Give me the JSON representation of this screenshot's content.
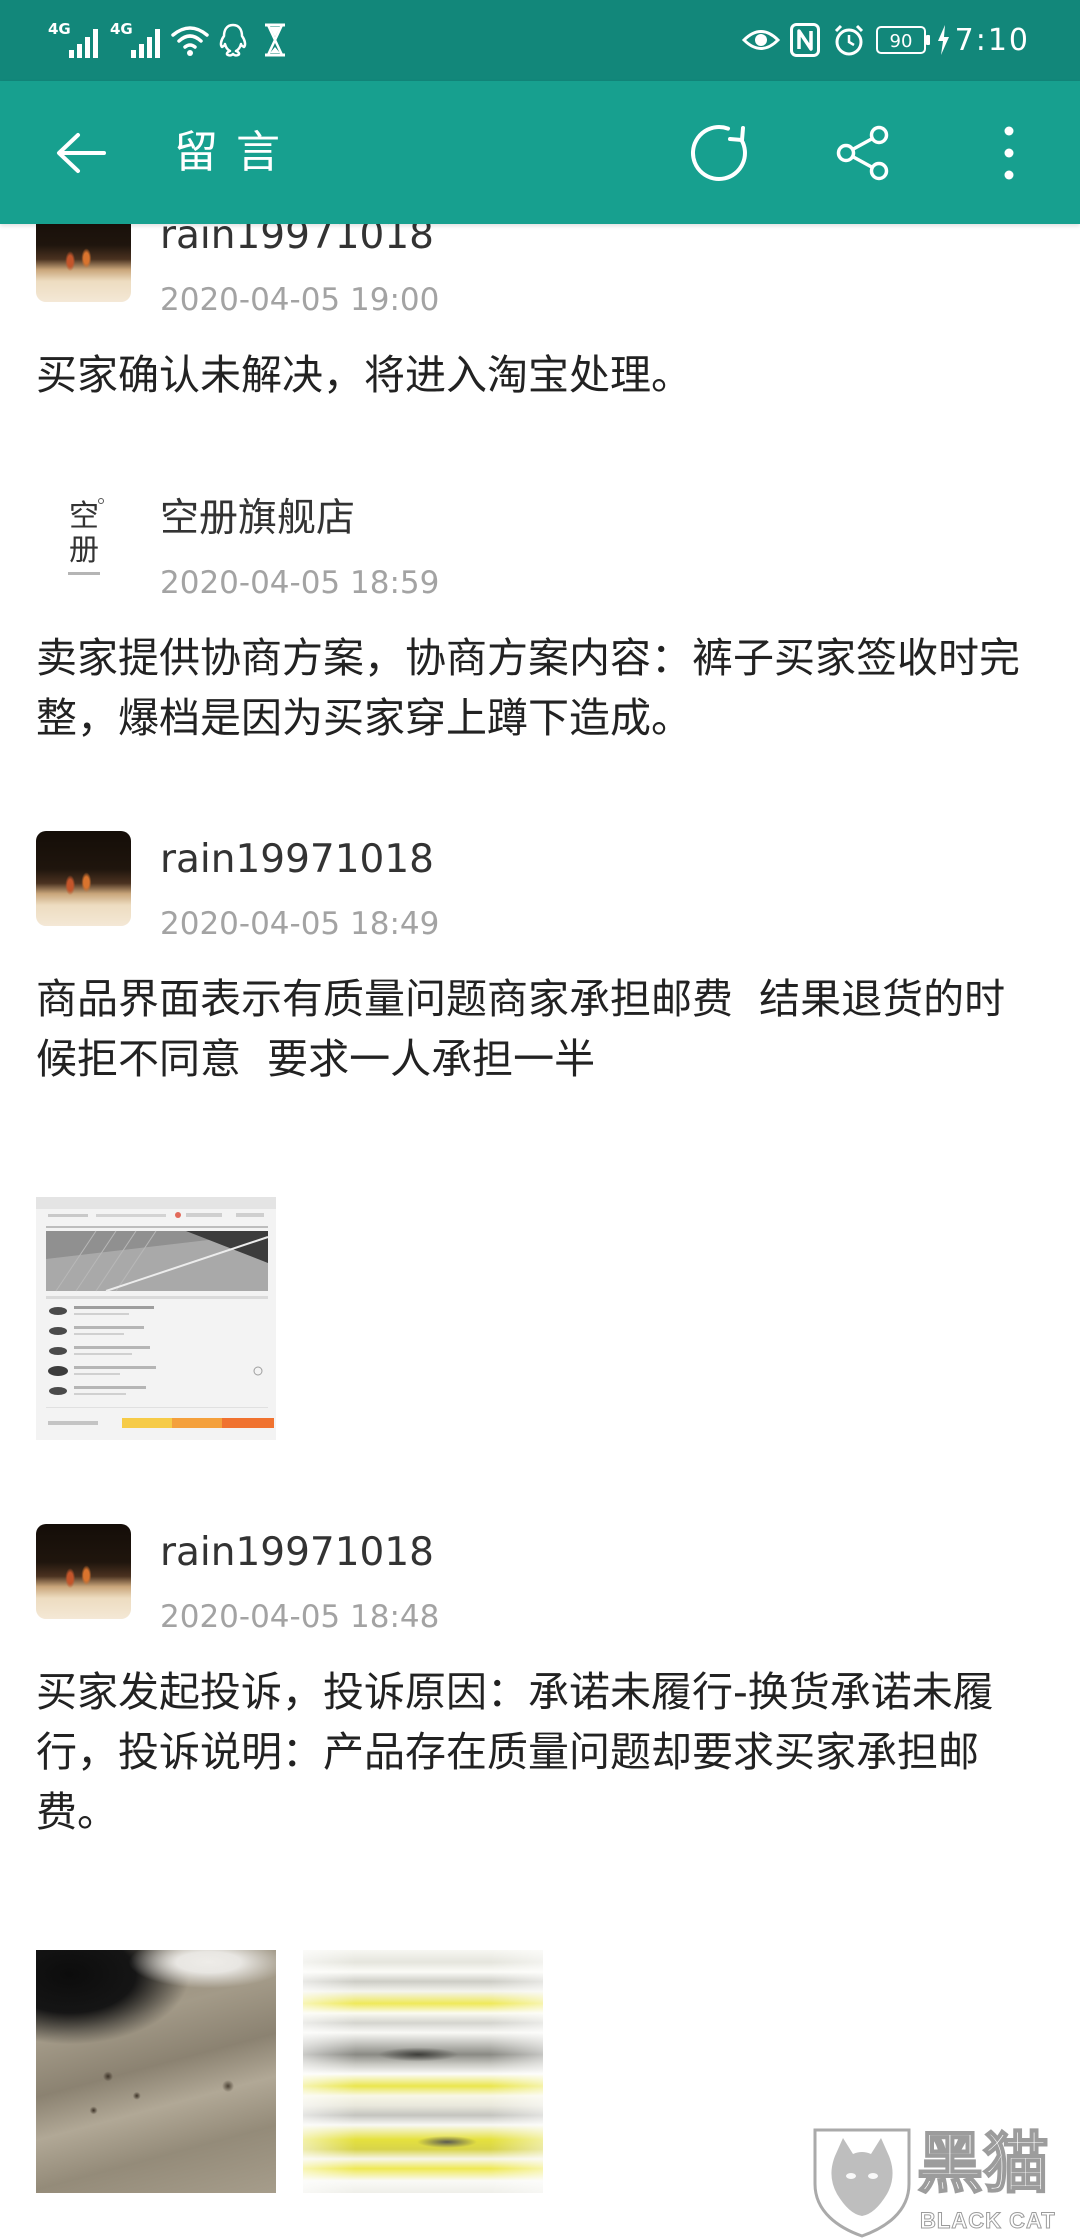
{
  "status_bar": {
    "sim1_network": "4G",
    "sim2_network": "4G",
    "battery_level": "90",
    "time": "7:10",
    "icons": {
      "left": [
        "signal-4g-icon",
        "signal-4g-icon",
        "wifi-icon",
        "qq-icon",
        "hourglass-icon"
      ],
      "right": [
        "eye-icon",
        "nfc-icon",
        "alarm-icon",
        "battery-icon",
        "charging-icon"
      ]
    }
  },
  "app_bar": {
    "title": "留言",
    "icons": {
      "back": "arrow-left-icon",
      "refresh": "refresh-icon",
      "share": "share-icon",
      "more": "more-vertical-icon"
    }
  },
  "colors": {
    "status_bar": "#12877a",
    "app_bar": "#17a08f",
    "author": "#333333",
    "timestamp": "#a3a3a3",
    "body": "#222222",
    "background": "#ffffff"
  },
  "messages": [
    {
      "author": "rain19971018",
      "time": "2020-04-05 19:00",
      "body_lines": [
        "买家确认未解决，将进入淘宝处理。"
      ]
    },
    {
      "author": "空册旗舰店",
      "avatar_text": "空册",
      "time": "2020-04-05 18:59",
      "body_lines": [
        "卖家提供协商方案，协商方案内容：裤子买家签收时完",
        "整，爆档是因为买家穿上蹲下造成。"
      ]
    },
    {
      "author": "rain19971018",
      "time": "2020-04-05 18:49",
      "body_lines": [
        "商品界面表示有质量问题商家承担邮费  结果退货的时",
        "候拒不同意  要求一人承担一半"
      ]
    },
    {
      "author": "rain19971018",
      "time": "2020-04-05 18:48",
      "body_lines": [
        "买家发起投诉，投诉原因：承诺未履行-换货承诺未履",
        "行，投诉说明：产品存在质量问题却要求买家承担邮",
        "费。"
      ]
    }
  ],
  "watermark": {
    "brand_cn": "黑猫",
    "brand_en": "BLACK CAT"
  }
}
